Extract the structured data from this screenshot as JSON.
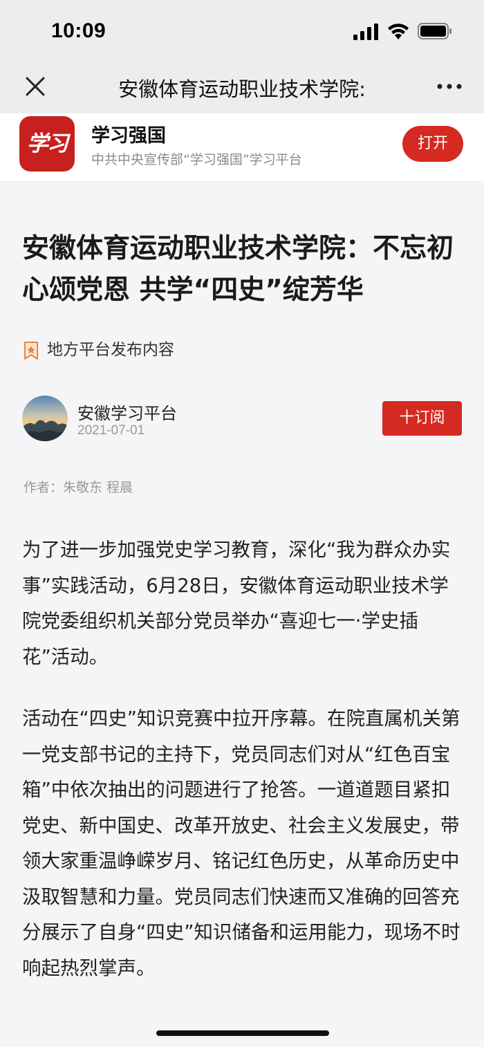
{
  "status_bar": {
    "time": "10:09"
  },
  "title_bar": {
    "title": "安徽体育运动职业技术学院:"
  },
  "app_banner": {
    "logo_text": "学习",
    "app_name": "学习强国",
    "description": "中共中央宣传部“学习强国”学习平台",
    "open_label": "打开",
    "brand_color": "#d42a22"
  },
  "article": {
    "title": "安徽体育运动职业技术学院：不忘初心颂党恩 共学“四史”绽芳华",
    "source_tag": "地方平台发布内容",
    "channel_name": "安徽学习平台",
    "publish_date": "2021-07-01",
    "subscribe_label": "十订阅",
    "byline": "作者：朱敬东 程晨",
    "paragraphs": [
      "为了进一步加强党史学习教育，深化“我为群众办实事”实践活动，6月28日，安徽体育运动职业技术学院党委组织机关部分党员举办“喜迎七一·学史插花”活动。",
      "活动在“四史”知识竞赛中拉开序幕。在院直属机关第一党支部书记的主持下，党员同志们对从“红色百宝箱”中依次抽出的问题进行了抢答。一道道题目紧扣党史、新中国史、改革开放史、社会主义发展史，带领大家重温峥嵘岁月、铭记红色历史，从革命历史中汲取智慧和力量。党员同志们快速而又准确的回答充分展示了自身“四史”知识储备和运用能力，现场不时响起热烈掌声。"
    ]
  },
  "icons": [
    "signal-icon",
    "wifi-icon",
    "battery-icon",
    "close-icon",
    "more-icon",
    "star-badge-icon"
  ]
}
